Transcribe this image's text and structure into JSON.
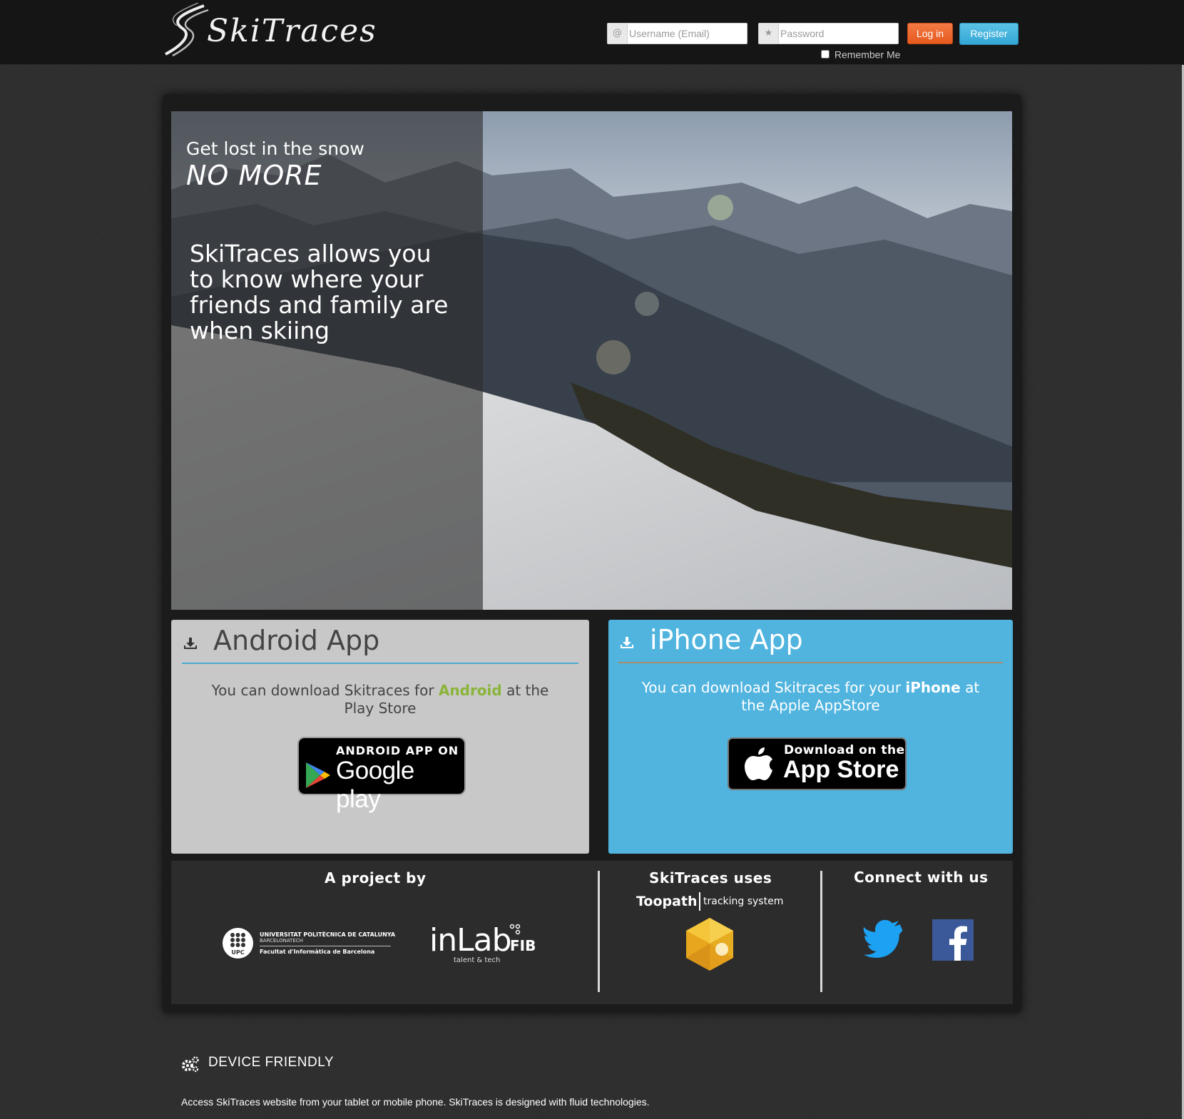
{
  "header": {
    "logo_text": "SkiTraces",
    "username_placeholder": "Username (Email)",
    "password_placeholder": "Password",
    "login_label": "Log in",
    "register_label": "Register",
    "remember_label": "Remember Me"
  },
  "hero": {
    "tagline_1": "Get lost in the snow",
    "tagline_2": "NO MORE",
    "description": "SkiTraces allows you to know where your friends and family are when skiing"
  },
  "android": {
    "title": "Android App",
    "text_before": "You can download Skitraces for ",
    "highlight": "Android",
    "text_after": " at the Play Store",
    "badge_top": "ANDROID APP ON",
    "badge_main": "Google play"
  },
  "iphone": {
    "title": "iPhone App",
    "text_before": "You can download Skitraces for your ",
    "highlight": "iPhone",
    "text_after": " at the Apple AppStore",
    "badge_top": "Download on the",
    "badge_main": "App Store"
  },
  "footer": {
    "project_title": "A project by",
    "upc_line1": "UNIVERSITAT POLITÈCNICA DE CATALUNYA",
    "upc_line2": "BARCELONATECH",
    "upc_line3": "Facultat d'Informàtica de Barcelona",
    "upc_seal": "UPC",
    "inlab_word": "inLab",
    "inlab_fib": "FIB",
    "inlab_tag": "talent & tech",
    "uses_title": "SkiTraces uses",
    "toopath_name": "Toopath",
    "toopath_sub": "tracking system",
    "connect_title": "Connect with us"
  },
  "feature": {
    "title": "DEVICE FRIENDLY",
    "text": "Access SkiTraces website from your tablet or mobile phone. SkiTraces is designed with fluid technologies."
  },
  "colors": {
    "accent_orange": "#e65a1e",
    "accent_blue": "#50b4df",
    "android_green": "#8ab43a",
    "facebook_blue": "#3b5998",
    "twitter_blue": "#1da1f2"
  }
}
